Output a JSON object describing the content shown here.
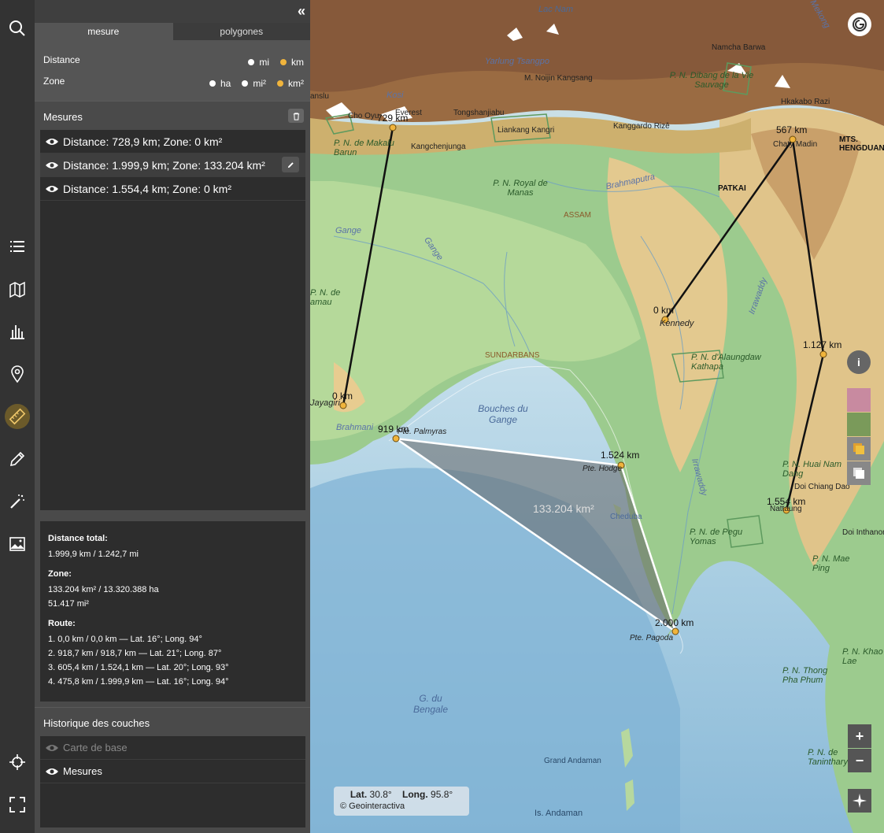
{
  "panel": {
    "collapse_label": "«",
    "tabs": [
      {
        "label": "mesure",
        "active": true
      },
      {
        "label": "polygones",
        "active": false
      }
    ],
    "distance": {
      "label": "Distance",
      "options": [
        "mi",
        "km"
      ],
      "selected": "km"
    },
    "zone": {
      "label": "Zone",
      "options": [
        "ha",
        "mi²",
        "km²"
      ],
      "selected": "km²"
    },
    "measures_title": "Mesures",
    "measures": [
      {
        "label": "Distance: 728,9 km; Zone: 0 km²",
        "selected": false
      },
      {
        "label": "Distance: 1.999,9 km; Zone: 133.204 km²",
        "selected": true
      },
      {
        "label": "Distance: 1.554,4 km; Zone: 0 km²",
        "selected": false
      }
    ],
    "stats": {
      "distance_title": "Distance total:",
      "distance_value": "1.999,9 km / 1.242,7 mi",
      "zone_title": "Zone:",
      "zone_value_1": "133.204 km² / 13.320.388 ha",
      "zone_value_2": "51.417 mi²",
      "route_title": "Route:",
      "route": [
        "1. 0,0 km / 0,0 km — Lat. 16°; Long. 94°",
        "2. 918,7 km / 918,7 km — Lat. 21°; Long. 87°",
        "3. 605,4 km / 1.524,1 km — Lat. 20°; Long. 93°",
        "4. 475,8 km / 1.999,9 km — Lat. 16°; Long. 94°"
      ]
    },
    "layers_title": "Historique des couches",
    "layers": [
      {
        "label": "Carte de base",
        "dim": true
      },
      {
        "label": "Mesures",
        "dim": false
      }
    ]
  },
  "rail": {
    "icons": [
      "search-icon",
      "list-icon",
      "map-icon",
      "chart-icon",
      "pin-icon",
      "ruler-icon",
      "pencil-icon",
      "magic-wand-icon",
      "image-icon",
      "crosshair-icon",
      "fullscreen-icon"
    ],
    "active": "ruler-icon"
  },
  "map": {
    "coords_lat_label": "Lat.",
    "coords_lat": "30.8°",
    "coords_long_label": "Long.",
    "coords_long": "95.8°",
    "copyright": "© Geointeractiva",
    "zoom_in": "+",
    "zoom_out": "−",
    "info": "i",
    "measure_labels": {
      "m1_start": "729 km",
      "m1_end": "0 km",
      "m2_a": "919 km",
      "m2_b": "1.524 km",
      "m2_c": "2.000 km",
      "m3_a": "567 km",
      "m3_b": "0 km",
      "m3_c": "1.127 km",
      "m3_d": "1.554 km",
      "area": "133.204 km²"
    },
    "places": {
      "lac_nam": "Lac Nam",
      "namcha": "Namcha Barwa",
      "yarlung": "Yarlung Tsangpo",
      "nojjin": "M. Noijin Kangsang",
      "dibang": "P. N. Dibang de la Vie Sauvage",
      "kosi": "Kosi",
      "everest": "Everest",
      "cho_oyu": "Cho Oyu",
      "tongshan": "Tongshanjiabu",
      "liankang": "Liankang Kangri",
      "kanggardo": "Kanggardo Rizê",
      "hkakabo": "Hkakabo Razi",
      "makalu": "P. N. de Makalu Barun",
      "kangchen": "Kangchenjunga",
      "chaty": "Chaty Madin",
      "hengduan": "MTS. HENGDUAN",
      "patkai": "PATKAI",
      "manas": "P. N. Royal de Manas",
      "brahmaputra": "Brahmaputra",
      "assam": "ASSAM",
      "gange": "Gange",
      "gange2": "Gange",
      "kennedy": "Kennedy",
      "irrawaddy": "Irrawaddy",
      "sundarbans": "SUNDARBANS",
      "alaungdaw": "P. N. d'Alaungdaw Kathapa",
      "jayagiri": "Jayagiri",
      "bouches": "Bouches du Gange",
      "brahmani": "Brahmani",
      "palmyras": "Pte. Palmyras",
      "hodge": "Pte. Hodge",
      "cheduba": "Cheduba",
      "irrawaddy2": "Irrawaddy",
      "huai": "P. N. Huai Nam Dang",
      "doi_chiang": "Doi Chiang Dao",
      "nattaung": "Nattaung",
      "pegu": "P. N. de Pegu Yomas",
      "doi_inthanon": "Doi Inthanon",
      "mae_ping": "P. N. Mae Ping",
      "pagoda": "Pte. Pagoda",
      "thong": "P. N. Thong Pha Phum",
      "khao": "P. N. Khao Lae",
      "bengale": "G. du Bengale",
      "grand_andaman": "Grand Andaman",
      "tanintharyi": "P. N. de Tanintharyi",
      "is_andaman": "Is. Andaman",
      "mekong": "Mekong",
      "ansalu": "anslu",
      "amau": "amau",
      "mitchell": "P. N. de"
    }
  }
}
